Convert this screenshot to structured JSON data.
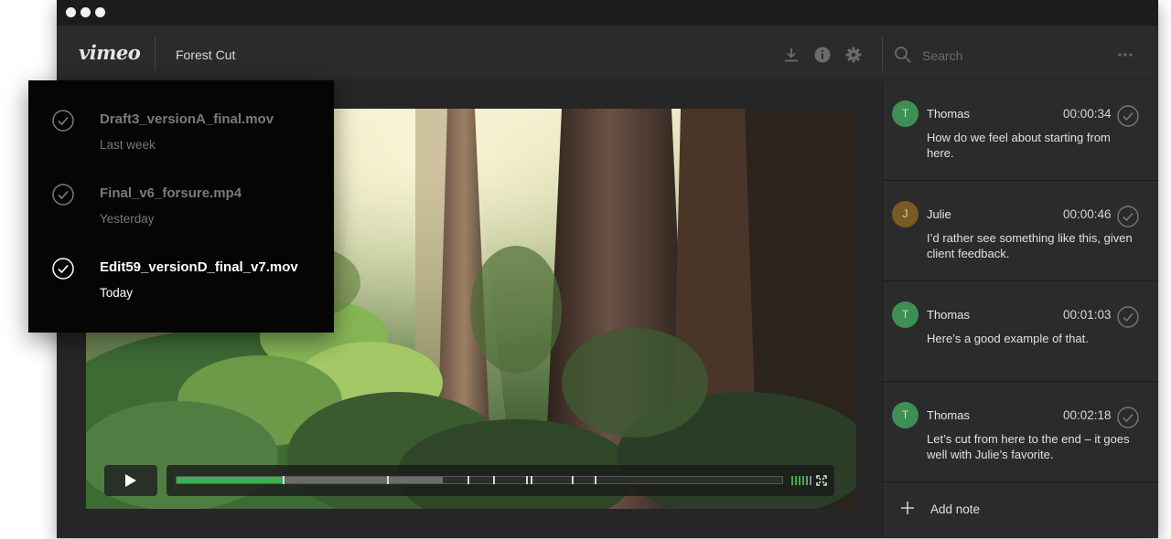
{
  "window": {
    "title": "Forest Cut",
    "brand": "vimeo"
  },
  "toolbar": {
    "icons": [
      "download-icon",
      "info-icon",
      "gear-icon"
    ]
  },
  "search": {
    "placeholder": "Search",
    "more_icon": "more-horizontal-icon"
  },
  "versions": [
    {
      "name": "Draft3_versionA_final.mov",
      "date": "Last week",
      "active": false
    },
    {
      "name": "Final_v6_forsure.mp4",
      "date": "Yesterday",
      "active": false
    },
    {
      "name": "Edit59_versionD_final_v7.mov",
      "date": "Today",
      "active": true
    }
  ],
  "player": {
    "progress_fraction": 0.175,
    "buffered_fraction": 0.44,
    "comment_marker_fractions": [
      0.175,
      0.347,
      0.481,
      0.523,
      0.577,
      0.584,
      0.652,
      0.69
    ],
    "play_icon": "play-icon",
    "volume_icon": "volume-bars-icon",
    "fullscreen_icon": "fullscreen-icon"
  },
  "notes": [
    {
      "author": "Thomas",
      "initial": "T",
      "time": "00:00:34",
      "text": "How do we feel about starting from here.",
      "avatar_color": "#3d8f53"
    },
    {
      "author": "Julie",
      "initial": "J",
      "time": "00:00:46",
      "text": "I’d rather see something like this, given client feedback.",
      "avatar_color": "#7a5a24"
    },
    {
      "author": "Thomas",
      "initial": "T",
      "time": "00:01:03",
      "text": "Here’s a good example of that.",
      "avatar_color": "#3d8f53"
    },
    {
      "author": "Thomas",
      "initial": "T",
      "time": "00:02:18",
      "text": "Let’s cut from here to the end – it goes well with Julie’s favorite.",
      "avatar_color": "#3d8f53"
    }
  ],
  "add_note": {
    "label": "Add note"
  },
  "colors": {
    "accent_green": "#3bb14a",
    "window_bg": "#2a2a2a",
    "dropdown_bg": "#050505"
  }
}
